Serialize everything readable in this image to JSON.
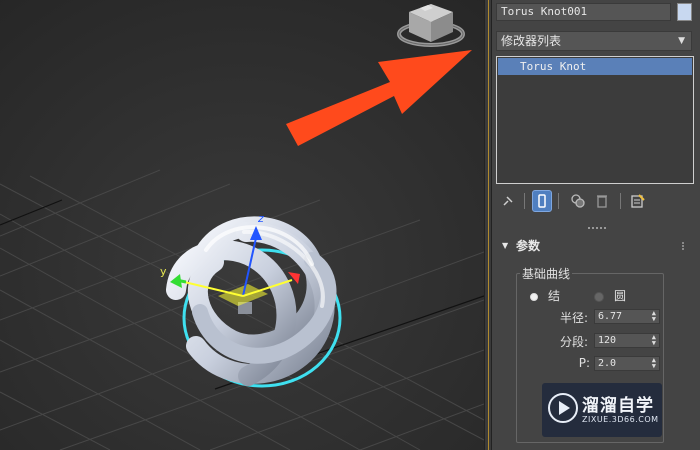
{
  "object": {
    "name": "Torus Knot001",
    "color": "#c8d8f0"
  },
  "modifier_list": {
    "label": "修改器列表"
  },
  "stack": {
    "items": [
      {
        "label": "Torus Knot"
      }
    ]
  },
  "rollout": {
    "title": "参数",
    "base_curve": {
      "title": "基础曲线",
      "options": [
        {
          "label": "结",
          "selected": true
        },
        {
          "label": "圆",
          "selected": false
        }
      ],
      "params": [
        {
          "label": "半径:",
          "value": "6.77"
        },
        {
          "label": "分段:",
          "value": "120"
        },
        {
          "label": "P:",
          "value": "2.0"
        }
      ]
    }
  },
  "viewport": {
    "axis_labels": {
      "y": "y",
      "z": "z"
    },
    "accent_colors": {
      "selection_outline": "#3fe0f0",
      "arrow": "#ff4a1c",
      "axis_z": "#2255ff",
      "axis_y": "#33dd33",
      "axis_x": "#ff3333",
      "axis_plane": "#ffff33"
    }
  },
  "watermark": {
    "title": "溜溜自学",
    "url": "ZIXUE.3D66.COM"
  }
}
